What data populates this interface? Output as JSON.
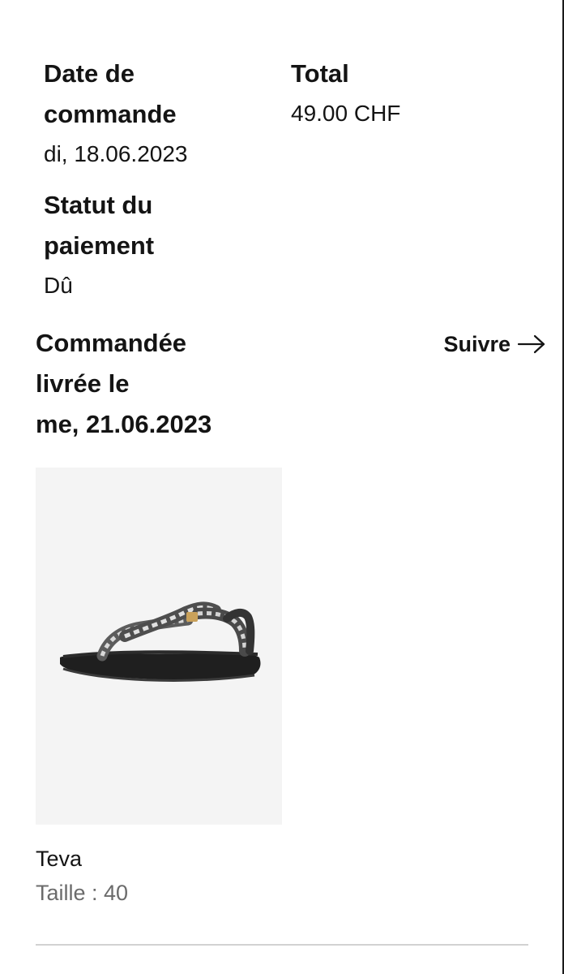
{
  "order": {
    "date_label": "Date de\ncommande",
    "date_value": "di, 18.06.2023",
    "total_label": "Total",
    "total_value": "49.00 CHF",
    "payment_label": "Statut du\npaiement",
    "payment_value": "Dû"
  },
  "delivery": {
    "title_line1": "Commandée",
    "title_line2": "livrée le",
    "title_line3": "me, 21.06.2023",
    "track_label": "Suivre",
    "track_icon": "arrow-right-icon"
  },
  "product": {
    "image_alt": "sandal",
    "brand": "Teva",
    "size": "Taille : 40"
  },
  "colors": {
    "text": "#141414",
    "muted": "#6b6b6b",
    "image_bg": "#f4f4f4",
    "divider": "#d2d2d2"
  }
}
